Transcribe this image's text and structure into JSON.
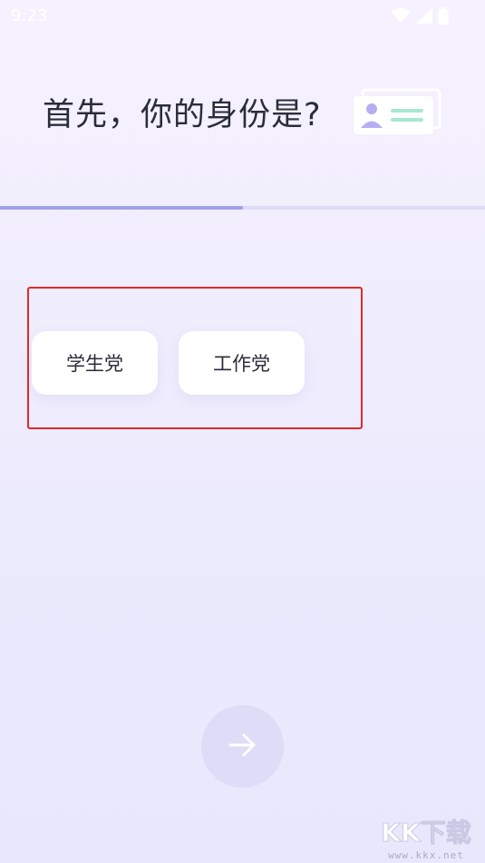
{
  "status_bar": {
    "time": "9:23",
    "icons": [
      "wifi-icon",
      "signal-icon",
      "battery-icon"
    ]
  },
  "header": {
    "title": "首先，你的身份是?",
    "illustration": "id-card-icon"
  },
  "progress": {
    "value": 0.5
  },
  "options": [
    {
      "label": "学生党"
    },
    {
      "label": "工作党"
    }
  ],
  "next_button": {
    "icon": "arrow-right-icon"
  },
  "watermark": {
    "logo_text": "KK下载",
    "url": "www.kkx.net"
  },
  "colors": {
    "progress_fill": "#9ea3e4",
    "progress_track": "#dcdcf7",
    "highlight_border": "#e02a2a",
    "next_button_bg": "#dedcf7",
    "title_text": "#2a2d3a"
  }
}
